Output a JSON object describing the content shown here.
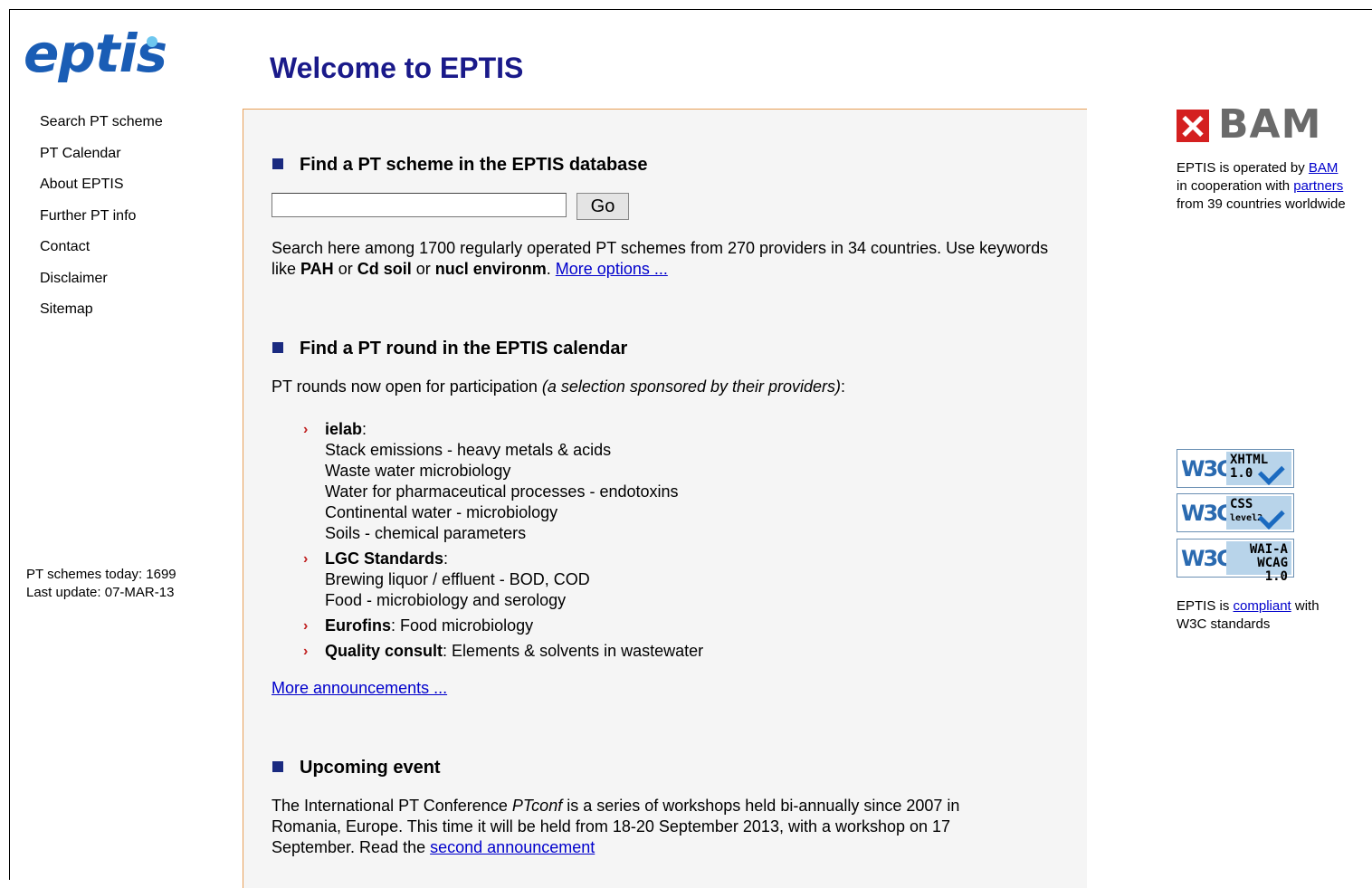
{
  "brand": {
    "logo_text": "eptis"
  },
  "header": {
    "title": "Welcome to EPTIS"
  },
  "nav": {
    "items": [
      "Search PT scheme",
      "PT Calendar",
      "About EPTIS",
      "Further PT info",
      "Contact",
      "Disclaimer",
      "Sitemap"
    ]
  },
  "stats": {
    "schemes_today": "PT schemes today: 1699",
    "last_update": "Last update: 07-MAR-13"
  },
  "search": {
    "heading": "Find a PT scheme in the EPTIS database",
    "input_value": "",
    "go_label": "Go",
    "desc_1": "Search here among 1700 regularly operated PT schemes from 270 providers in 34 countries. Use keywords like ",
    "kw1": "PAH",
    "or1": " or ",
    "kw2": "Cd soil",
    "or2": " or ",
    "kw3": "nucl environm",
    "dot": ". ",
    "more_options": "More options ..."
  },
  "calendar": {
    "heading": "Find a PT round in the EPTIS calendar",
    "intro": "PT rounds now open for participation ",
    "intro_italic": "(a selection sponsored by their providers)",
    "intro_end": ":",
    "rounds": [
      {
        "provider": "ielab",
        "items": [
          "Stack emissions - heavy metals & acids",
          "Waste water microbiology",
          "Water for pharmaceutical processes - endotoxins",
          "Continental water - microbiology",
          "Soils - chemical parameters"
        ]
      },
      {
        "provider": "LGC Standards",
        "items": [
          "Brewing liquor / effluent - BOD, COD",
          "Food - microbiology and serology"
        ]
      },
      {
        "provider": "Eurofins",
        "inline": "Food microbiology"
      },
      {
        "provider": "Quality consult",
        "inline": "Elements & solvents in wastewater"
      }
    ],
    "more_announcements": "More announcements ..."
  },
  "event": {
    "heading": "Upcoming event",
    "text_1": "The International PT Conference ",
    "text_italic": "PTconf",
    "text_2": " is a series of workshops held bi-annually since 2007 in Romania, Europe. This time it will be held from 18-20 September 2013, with a workshop on 17 September. Read the ",
    "link": "second announcement"
  },
  "sidebar_right": {
    "bam_logo_text": "BAM",
    "op_1": "EPTIS is operated by ",
    "op_link_bam": "BAM",
    "op_2": "in cooperation with ",
    "op_link_partners": "partners",
    "op_3": "from 39 countries worldwide",
    "badges": [
      {
        "logo": "W3C",
        "line1": "XHTML",
        "line2": "1.0"
      },
      {
        "logo": "W3C",
        "line1": "CSS",
        "line2": "level2"
      },
      {
        "logo": "W3C",
        "line1": "WAI-A",
        "line2": "WCAG 1.0"
      }
    ],
    "compliant_1": "EPTIS is ",
    "compliant_link": "compliant",
    "compliant_2": " with",
    "compliant_3": "W3C standards"
  },
  "colors": {
    "title": "#1a1a8a",
    "logo": "#1a5db5",
    "link": "#0000cc",
    "bullet": "#c02020",
    "panel_border": "#e8a058",
    "panel_bg": "#f5f5f5"
  }
}
